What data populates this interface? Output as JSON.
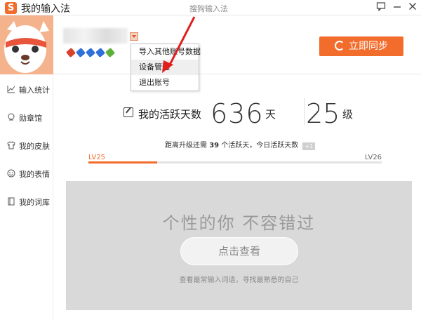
{
  "window": {
    "logo_char": "S",
    "title": "我的输入法",
    "subtitle": "搜狗输入法",
    "feedback_icon": "feedback-icon",
    "minimize_icon": "minimize-icon",
    "close_icon": "close-icon"
  },
  "header": {
    "sync_label": "立即同步",
    "pen_colors": [
      "#d9412b",
      "#2f6fd8",
      "#2f6fd8",
      "#2f6fd8",
      "#5cb03a"
    ]
  },
  "menu": {
    "items": [
      {
        "label": "导入其他账号数据"
      },
      {
        "label": "设备管理"
      },
      {
        "label": "退出账号"
      }
    ]
  },
  "sidebar": {
    "items": [
      {
        "label": "输入统计",
        "icon": "chart-icon"
      },
      {
        "label": "勋章馆",
        "icon": "medal-icon"
      },
      {
        "label": "我的皮肤",
        "icon": "shirt-icon"
      },
      {
        "label": "我的表情",
        "icon": "smiley-icon"
      },
      {
        "label": "我的词库",
        "icon": "book-icon"
      }
    ]
  },
  "stats": {
    "label": "我的活跃天数",
    "active_days": "636",
    "days_unit": "天",
    "level": "25",
    "level_unit": "级"
  },
  "upgrade": {
    "prefix": "距离升级还需",
    "days": "39",
    "middle": "个活跃天，今日活跃天数",
    "today_value": "+1"
  },
  "progress": {
    "current_level": "LV25",
    "next_level": "LV26",
    "fraction": 0.235
  },
  "promo": {
    "slogan": "个性的你  不容错过",
    "button_label": "点击查看",
    "note": "查看最常输入词语，寻找最熟悉的自己"
  },
  "colors": {
    "accent": "#f26c2b",
    "panel_bg": "#d9d9d9"
  }
}
